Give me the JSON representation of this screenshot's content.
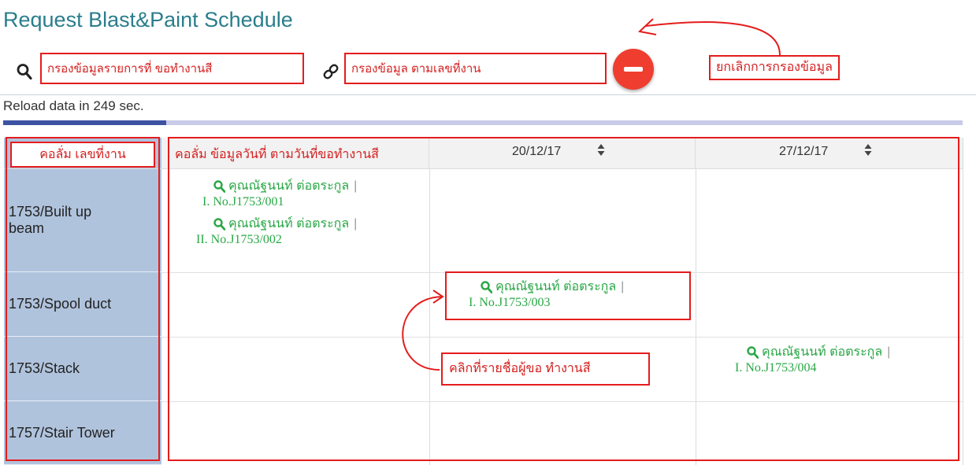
{
  "page": {
    "title": "Request Blast&Paint Schedule",
    "reload_text": "Reload data in 249 sec.",
    "reload_progress": 0.17
  },
  "filters": {
    "request_filter_placeholder": "กรองข้อมูลรายการที่ ขอทำงานสี",
    "job_filter_placeholder": "กรองข้อมูล ตามเลขที่งาน"
  },
  "annotations": {
    "cancel_filter": "ยกเลิกการกรองข้อมูล",
    "job_column": "คอลั่ม เลขที่งาน",
    "date_column": "คอลั่ม ข้อมูลวันที่ ตามวันที่ขอทำงานสี",
    "click_hint": "คลิกที่รายชื่อผู้ขอ ทำงานสี"
  },
  "grid": {
    "dates": [
      "20/12/17",
      "27/12/17"
    ],
    "rows": [
      {
        "label_lines": [
          "1753/Built up",
          "beam"
        ]
      },
      {
        "label_lines": [
          "1753/Spool duct"
        ]
      },
      {
        "label_lines": [
          "1753/Stack"
        ]
      },
      {
        "label_lines": [
          "1757/Stair Tower"
        ]
      }
    ],
    "requests": [
      {
        "name": "คุณณัฐนนท์ ต่อตระกูล",
        "job": "I. No.J1753/001"
      },
      {
        "name": "คุณณัฐนนท์ ต่อตระกูล",
        "job": "II. No.J1753/002"
      },
      {
        "name": "คุณณัฐนนท์ ต่อตระกูล",
        "job": "I. No.J1753/003"
      },
      {
        "name": "คุณณัฐนนท์ ต่อตระกูล",
        "job": "I. No.J1753/004"
      }
    ],
    "separator": "|"
  },
  "colors": {
    "title": "#2a7d8c",
    "request_text": "#28a745",
    "annotation": "#e51c1c",
    "cancel_button": "#ef3e2f",
    "row_header": "#b0c3dd",
    "progress": "#3c53a3"
  },
  "icons": {
    "search": "search-icon",
    "link": "link-icon",
    "cancel": "minus-circle-icon",
    "sort": "sort-icon"
  }
}
